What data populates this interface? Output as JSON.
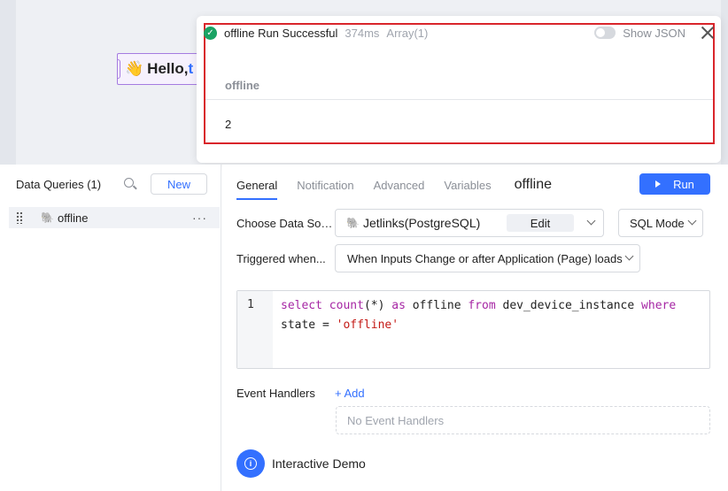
{
  "canvas": {
    "widget_text": "Hello, ",
    "widget_emoji": "👋",
    "widget_tail": "t"
  },
  "result": {
    "title": "offline Run Successful",
    "duration": "374ms",
    "type": "Array(1)",
    "show_json_label": "Show JSON",
    "show_json_enabled": false,
    "columns": [
      "offline"
    ],
    "rows": [
      [
        "2"
      ]
    ]
  },
  "sidebar": {
    "title": "Data Queries (1)",
    "new_label": "New",
    "queries": [
      {
        "label": "offline",
        "icon": "postgresql-icon",
        "more": "···"
      }
    ]
  },
  "config": {
    "tabs": [
      "General",
      "Notification",
      "Advanced",
      "Variables"
    ],
    "active_tab": "General",
    "query_name": "offline",
    "run_label": "Run",
    "datasource_label": "Choose Data So…",
    "datasource_value": "Jetlinks(PostgreSQL)",
    "edit_label": "Edit",
    "mode_value": "SQL Mode",
    "trigger_label": "Triggered when...",
    "trigger_value": "When Inputs Change or after Application (Page) loads",
    "editor": {
      "line_number": "1",
      "code": "select count(*) as offline from dev_device_instance where state = 'offline'"
    },
    "event_handlers_label": "Event Handlers",
    "add_label": "+ Add",
    "no_handlers_label": "No Event Handlers",
    "demo_label": "Interactive Demo"
  },
  "colors": {
    "accent": "#3370ff",
    "success": "#1aa364",
    "highlight_border": "#d9252b"
  }
}
